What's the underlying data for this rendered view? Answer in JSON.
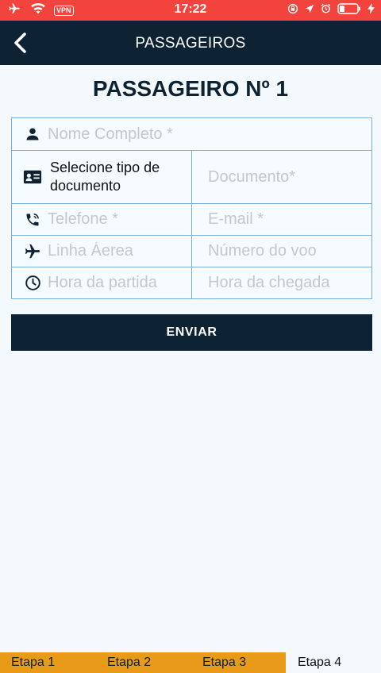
{
  "status_bar": {
    "vpn": "VPN",
    "time": "17:22"
  },
  "header": {
    "title": "PASSAGEIROS"
  },
  "form": {
    "title": "PASSAGEIRO Nº 1",
    "name_placeholder": "Nome Completo *",
    "doc_type_label": "Selecione tipo de documento",
    "document_placeholder": "Documento*",
    "phone_placeholder": "Telefone *",
    "email_placeholder": "E-mail *",
    "airline_placeholder": "Linha Áerea",
    "flight_placeholder": "Número do voo",
    "departure_placeholder": "Hora da partida",
    "arrival_placeholder": "Hora da chegada",
    "submit_label": "ENVIAR"
  },
  "steps": [
    "Etapa 1",
    "Etapa 2",
    "Etapa 3",
    "Etapa 4"
  ],
  "colors": {
    "status_bar": "#f2433c",
    "header": "#0d2233",
    "accent": "#e89a18",
    "border": "#7aaed6"
  }
}
